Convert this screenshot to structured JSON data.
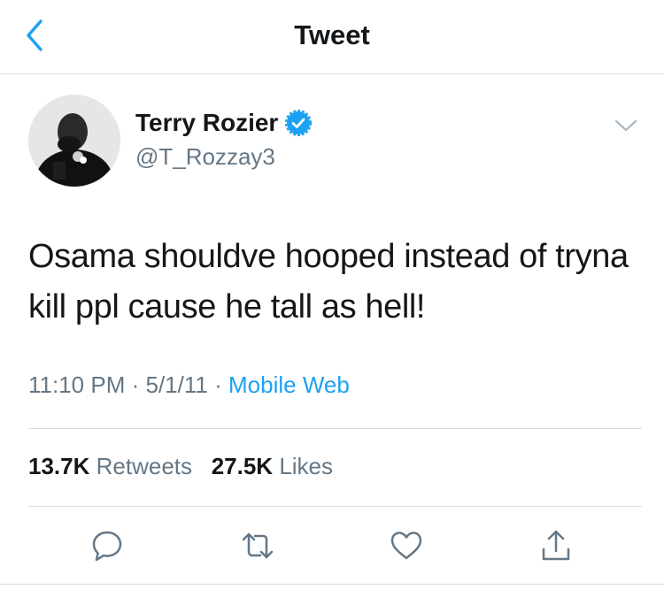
{
  "header": {
    "title": "Tweet",
    "back_icon": "chevron-left-icon"
  },
  "tweet": {
    "author_name": "Terry Rozier",
    "author_handle": "@T_Rozzay3",
    "verified": true,
    "text": "Osama shouldve hooped instead of tryna kill ppl cause he tall as hell!",
    "time": "11:10 PM",
    "date": "5/1/11",
    "separator": "·",
    "source": "Mobile Web"
  },
  "stats": {
    "retweets_count": "13.7K",
    "retweets_label": "Retweets",
    "likes_count": "27.5K",
    "likes_label": "Likes"
  },
  "actions": [
    "reply-icon",
    "retweet-icon",
    "like-icon",
    "share-icon"
  ],
  "colors": {
    "accent": "#1da1f2",
    "text": "#14171a",
    "secondary": "#657786",
    "divider": "#d8dde2"
  }
}
